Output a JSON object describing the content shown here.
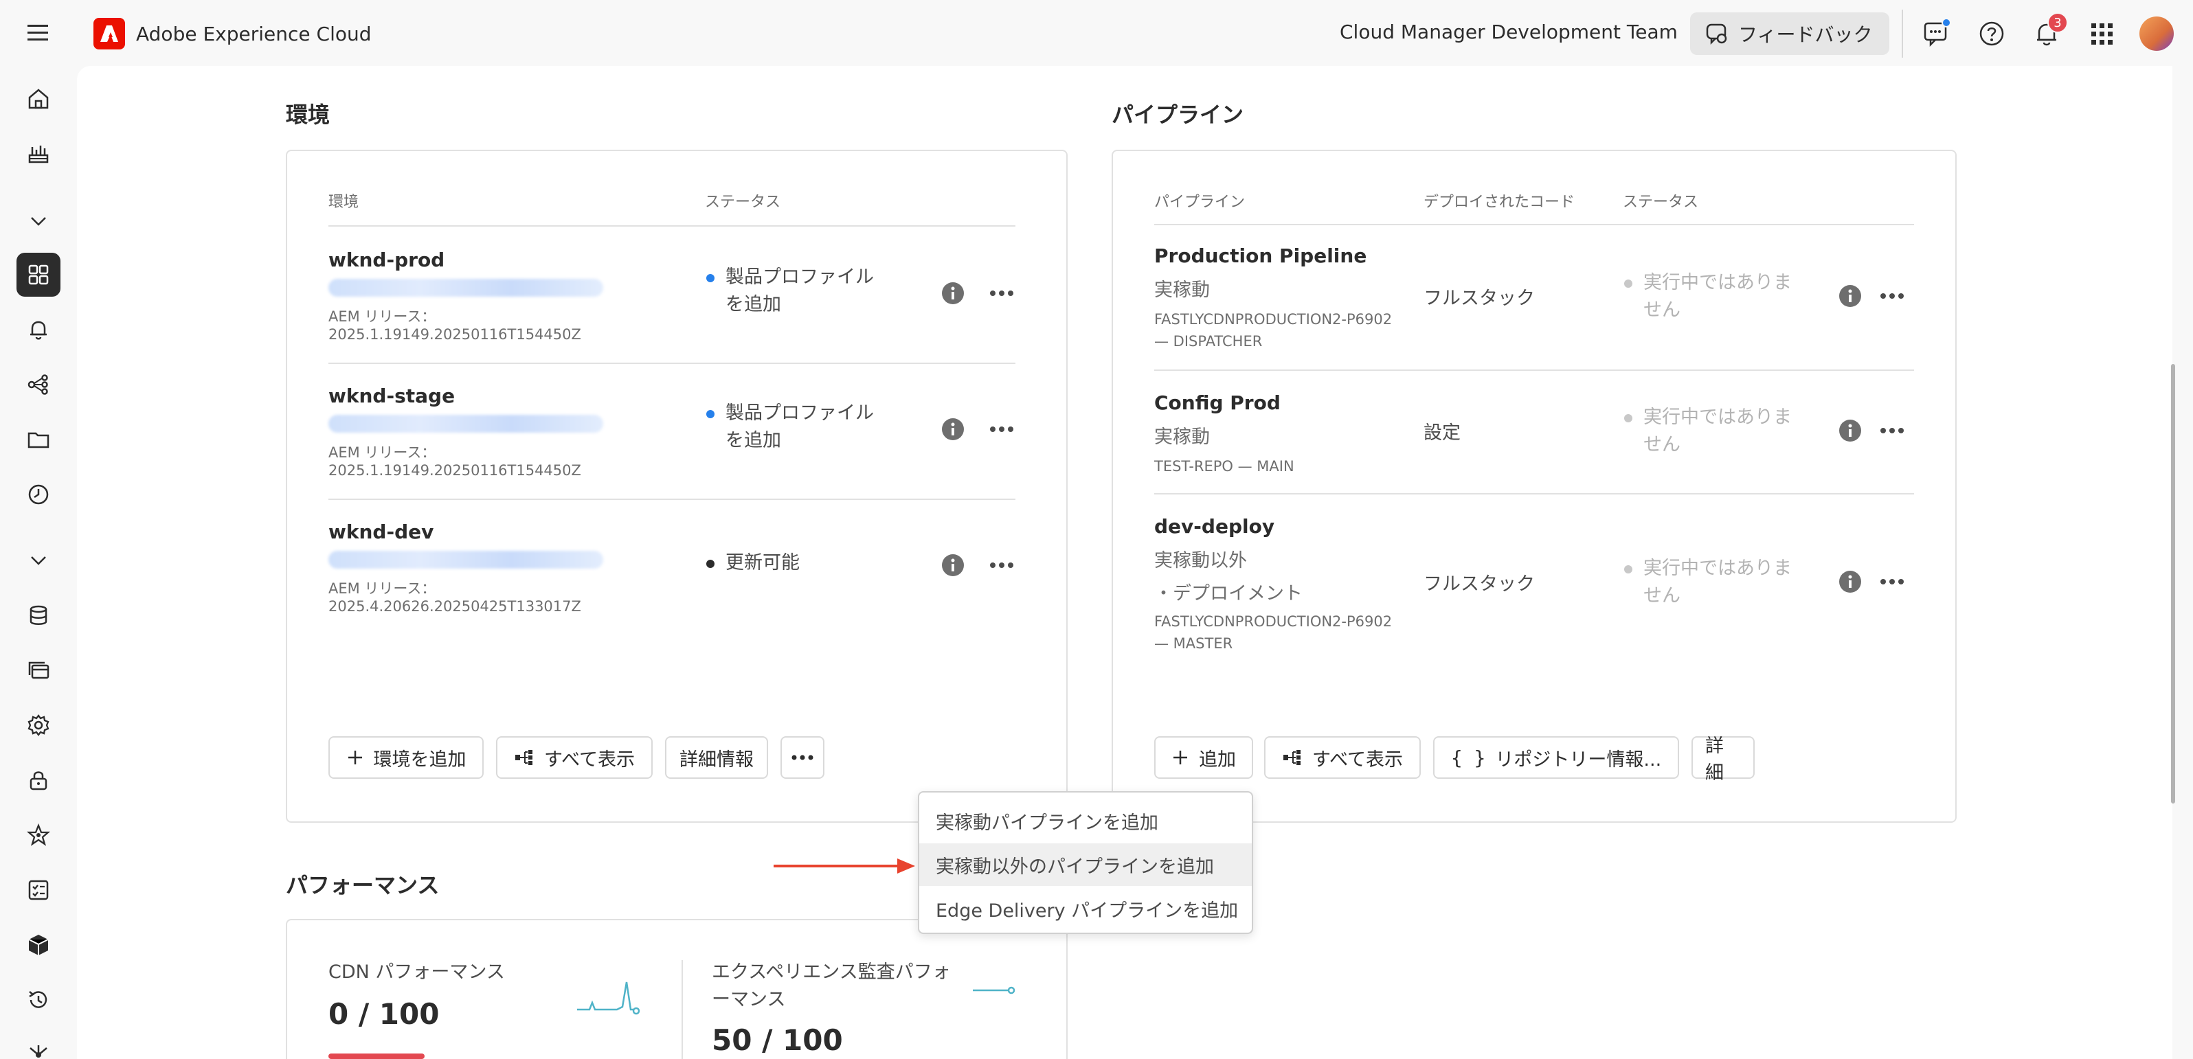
{
  "topbar": {
    "brand": "Adobe Experience Cloud",
    "org": "Cloud Manager Development Team",
    "feedback": "フィードバック",
    "notification_count": "3"
  },
  "environments": {
    "title": "環境",
    "col_env": "環境",
    "col_status": "ステータス",
    "rows": [
      {
        "name": "wknd-prod",
        "release_label": "AEM リリース：",
        "release": "2025.1.19149.20250116T154450Z",
        "status_line1": "製品プロファイル",
        "status_line2": "を追加",
        "status_color": "#2680eb"
      },
      {
        "name": "wknd-stage",
        "release_label": "AEM リリース：",
        "release": "2025.1.19149.20250116T154450Z",
        "status_line1": "製品プロファイル",
        "status_line2": "を追加",
        "status_color": "#2680eb"
      },
      {
        "name": "wknd-dev",
        "release_label": "AEM リリース：",
        "release": "2025.4.20626.20250425T133017Z",
        "status_line1": "更新可能",
        "status_line2": "",
        "status_color": "#2c2c2c"
      }
    ],
    "buttons": {
      "add": "環境を追加",
      "show_all": "すべて表示",
      "details": "詳細情報"
    }
  },
  "pipelines": {
    "title": "パイプライン",
    "col_pipeline": "パイプライン",
    "col_code": "デプロイされたコード",
    "col_status": "ステータス",
    "rows": [
      {
        "name": "Production Pipeline",
        "type": "実稼動",
        "type2": "",
        "repo_line1": "FASTLYCDNPRODUCTION2-P6902",
        "repo_line2": "— DISPATCHER",
        "code": "フルスタック",
        "status_line1": "実行中ではありま",
        "status_line2": "せん"
      },
      {
        "name": "Config Prod",
        "type": "実稼動",
        "type2": "",
        "repo_line1": "TEST-REPO — MAIN",
        "repo_line2": "",
        "code": "設定",
        "status_line1": "実行中ではありま",
        "status_line2": "せん"
      },
      {
        "name": "dev-deploy",
        "type": "実稼動以外",
        "type2": "・デプロイメント",
        "repo_line1": "FASTLYCDNPRODUCTION2-P6902",
        "repo_line2": "— MASTER",
        "code": "フルスタック",
        "status_line1": "実行中ではありま",
        "status_line2": "せん"
      }
    ],
    "buttons": {
      "add": "追加",
      "show_all": "すべて表示",
      "repo_info": "リポジトリー情報...",
      "details": "詳細"
    }
  },
  "menu": {
    "items": [
      "実稼動パイプラインを追加",
      "実稼動以外のパイプラインを追加",
      "Edge Delivery パイプラインを追加"
    ]
  },
  "performance": {
    "title": "パフォーマンス",
    "cdn_label": "CDN パフォーマンス",
    "cdn_value": "0 / 100",
    "exp_label_line1": "エクスペリエンス監査パフォ",
    "exp_label_line2": "ーマンス",
    "exp_value": "50 / 100"
  },
  "colors": {
    "accent_blue": "#2680eb",
    "adobe_red": "#eb1000",
    "arrow_red": "#e8432e",
    "badge_red": "#e34850"
  }
}
